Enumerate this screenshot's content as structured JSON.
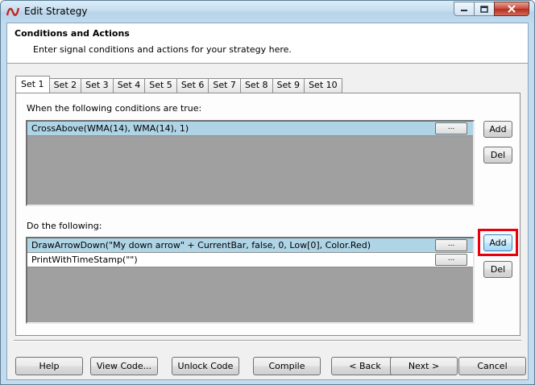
{
  "window": {
    "title": "Edit Strategy"
  },
  "header": {
    "title": "Conditions and Actions",
    "description": "Enter signal conditions and actions for your strategy here."
  },
  "tabs": [
    {
      "label": "Set 1",
      "active": true
    },
    {
      "label": "Set 2",
      "active": false
    },
    {
      "label": "Set 3",
      "active": false
    },
    {
      "label": "Set 4",
      "active": false
    },
    {
      "label": "Set 5",
      "active": false
    },
    {
      "label": "Set 6",
      "active": false
    },
    {
      "label": "Set 7",
      "active": false
    },
    {
      "label": "Set 8",
      "active": false
    },
    {
      "label": "Set 9",
      "active": false
    },
    {
      "label": "Set 10",
      "active": false
    }
  ],
  "conditions": {
    "label": "When the following conditions are true:",
    "rows": [
      {
        "text": "CrossAbove(WMA(14), WMA(14), 1)",
        "button": "...",
        "selected": true
      }
    ],
    "add_label": "Add",
    "del_label": "Del"
  },
  "actions": {
    "label": "Do the following:",
    "rows": [
      {
        "text": "DrawArrowDown(\"My down arrow\" + CurrentBar, false, 0, Low[0], Color.Red)",
        "button": "...",
        "selected": true
      },
      {
        "text": "PrintWithTimeStamp(\"\")",
        "button": "...",
        "selected": false
      }
    ],
    "add_label": "Add",
    "del_label": "Del"
  },
  "footer": {
    "help": "Help",
    "view_code": "View Code...",
    "unlock_code": "Unlock Code",
    "compile": "Compile",
    "back": "< Back",
    "next": "Next >",
    "cancel": "Cancel"
  },
  "colors": {
    "selected_row": "#aed4e5",
    "highlight": "#e8000d",
    "titlebar": "#c6deef"
  }
}
